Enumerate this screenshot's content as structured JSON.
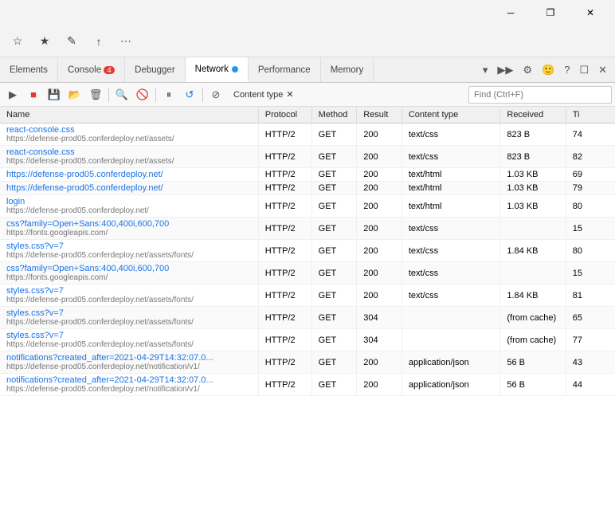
{
  "titleBar": {
    "minimizeLabel": "─",
    "restoreLabel": "❐",
    "closeLabel": "✕"
  },
  "browserToolbar": {
    "icons": [
      "◀",
      "▶",
      "↺",
      "☆",
      "⟳",
      "⋯"
    ]
  },
  "devtoolsTabs": [
    {
      "id": "elements",
      "label": "Elements",
      "active": false
    },
    {
      "id": "console",
      "label": "Console",
      "badge": "4",
      "active": false
    },
    {
      "id": "debugger",
      "label": "Debugger",
      "active": false
    },
    {
      "id": "network",
      "label": "Network",
      "dot": true,
      "active": true
    },
    {
      "id": "performance",
      "label": "Performance",
      "active": false
    },
    {
      "id": "memory",
      "label": "Memory",
      "active": false
    }
  ],
  "devtoolsIcons": [
    "▾",
    "▶▶",
    "✕",
    "⋯"
  ],
  "networkToolbar": {
    "filterLabel": "Content type",
    "findPlaceholder": "Find (Ctrl+F)"
  },
  "tableHeaders": [
    "Name",
    "Protocol",
    "Method",
    "Result",
    "Content type",
    "Received",
    "Ti"
  ],
  "rows": [
    {
      "name": "react-console.css",
      "url": "https://defense-prod05.conferdeploy.net/assets/",
      "protocol": "HTTP/2",
      "method": "GET",
      "result": "200",
      "contentType": "text/css",
      "received": "823 B",
      "time": "74"
    },
    {
      "name": "react-console.css",
      "url": "https://defense-prod05.conferdeploy.net/assets/",
      "protocol": "HTTP/2",
      "method": "GET",
      "result": "200",
      "contentType": "text/css",
      "received": "823 B",
      "time": "82"
    },
    {
      "name": "https://defense-prod05.conferdeploy.net/",
      "url": "",
      "protocol": "HTTP/2",
      "method": "GET",
      "result": "200",
      "contentType": "text/html",
      "received": "1.03 KB",
      "time": "69"
    },
    {
      "name": "https://defense-prod05.conferdeploy.net/",
      "url": "",
      "protocol": "HTTP/2",
      "method": "GET",
      "result": "200",
      "contentType": "text/html",
      "received": "1.03 KB",
      "time": "79"
    },
    {
      "name": "login",
      "url": "https://defense-prod05.conferdeploy.net/",
      "protocol": "HTTP/2",
      "method": "GET",
      "result": "200",
      "contentType": "text/html",
      "received": "1.03 KB",
      "time": "80"
    },
    {
      "name": "css?family=Open+Sans:400,400i,600,700",
      "url": "https://fonts.googleapis.com/",
      "protocol": "HTTP/2",
      "method": "GET",
      "result": "200",
      "contentType": "text/css",
      "received": "",
      "time": "15"
    },
    {
      "name": "styles.css?v=7",
      "url": "https://defense-prod05.conferdeploy.net/assets/fonts/",
      "protocol": "HTTP/2",
      "method": "GET",
      "result": "200",
      "contentType": "text/css",
      "received": "1.84 KB",
      "time": "80"
    },
    {
      "name": "css?family=Open+Sans:400,400i,600,700",
      "url": "https://fonts.googleapis.com/",
      "protocol": "HTTP/2",
      "method": "GET",
      "result": "200",
      "contentType": "text/css",
      "received": "",
      "time": "15"
    },
    {
      "name": "styles.css?v=7",
      "url": "https://defense-prod05.conferdeploy.net/assets/fonts/",
      "protocol": "HTTP/2",
      "method": "GET",
      "result": "200",
      "contentType": "text/css",
      "received": "1.84 KB",
      "time": "81"
    },
    {
      "name": "styles.css?v=7",
      "url": "https://defense-prod05.conferdeploy.net/assets/fonts/",
      "protocol": "HTTP/2",
      "method": "GET",
      "result": "304",
      "contentType": "",
      "received": "(from cache)",
      "time": "65"
    },
    {
      "name": "styles.css?v=7",
      "url": "https://defense-prod05.conferdeploy.net/assets/fonts/",
      "protocol": "HTTP/2",
      "method": "GET",
      "result": "304",
      "contentType": "",
      "received": "(from cache)",
      "time": "77"
    },
    {
      "name": "notifications?created_after=2021-04-29T14:32:07.0...",
      "url": "https://defense-prod05.conferdeploy.net/notification/v1/",
      "protocol": "HTTP/2",
      "method": "GET",
      "result": "200",
      "contentType": "application/json",
      "received": "56 B",
      "time": "43"
    },
    {
      "name": "notifications?created_after=2021-04-29T14:32:07.0...",
      "url": "https://defense-prod05.conferdeploy.net/notification/v1/",
      "protocol": "HTTP/2",
      "method": "GET",
      "result": "200",
      "contentType": "application/json",
      "received": "56 B",
      "time": "44"
    }
  ]
}
